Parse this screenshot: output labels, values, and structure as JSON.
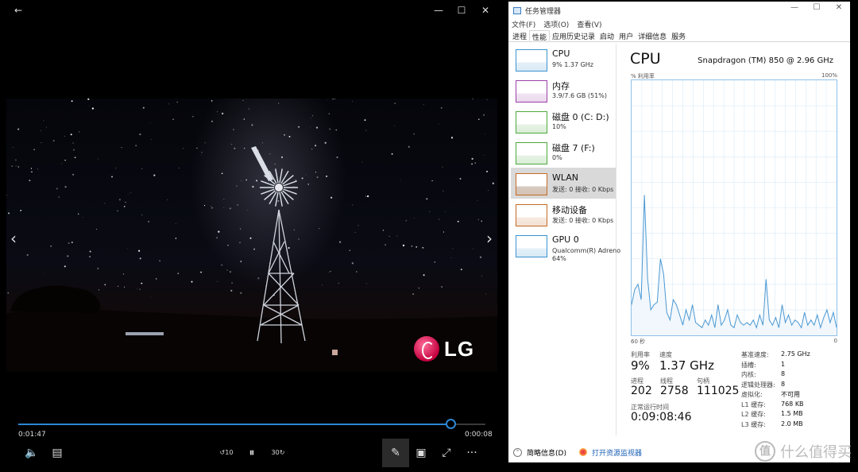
{
  "player": {
    "back_icon": "←",
    "minimize_icon": "—",
    "maximize_icon": "☐",
    "close_icon": "✕",
    "prev_icon": "‹",
    "next_icon": "›",
    "logo_text": "LG",
    "elapsed": "0:01:47",
    "remaining": "0:00:08",
    "progress": 0.925,
    "controls": {
      "volume_icon": "🔈",
      "subtitles_icon": "▤",
      "rewind_label": "10",
      "pause_icon": "⏸",
      "forward_label": "30",
      "edit_icon": "✎",
      "miniview_icon": "▣",
      "fullscreen_icon": "⤢",
      "more_icon": "···"
    }
  },
  "taskmanager": {
    "title": "任务管理器",
    "window_buttons": [
      "—",
      "☐",
      "✕"
    ],
    "menu": [
      "文件(F)",
      "选项(O)",
      "查看(V)"
    ],
    "tabs": [
      "进程",
      "性能",
      "应用历史记录",
      "启动",
      "用户",
      "详细信息",
      "服务"
    ],
    "selected_tab": 1,
    "sidebar": [
      {
        "name": "CPU",
        "sub": "9%  1.37 GHz",
        "color": "#3c92d0"
      },
      {
        "name": "内存",
        "sub": "3.9/7.6 GB (51%)",
        "color": "#9b3fa8"
      },
      {
        "name": "磁盘 0 (C: D:)",
        "sub": "10%",
        "color": "#4ca93c"
      },
      {
        "name": "磁盘 7 (F:)",
        "sub": "0%",
        "color": "#4ca93c"
      },
      {
        "name": "WLAN",
        "sub": "发送: 0  接收: 0 Kbps",
        "color": "#c46a24"
      },
      {
        "name": "移动设备",
        "sub": "发送: 0  接收: 0 Kbps",
        "color": "#c46a24"
      },
      {
        "name": "GPU 0",
        "sub": "Qualcomm(R) Adreno",
        "sub2": "64%",
        "color": "#3c92d0"
      }
    ],
    "selected_sidebar": 4,
    "main": {
      "title": "CPU",
      "model": "Snapdragon (TM) 850 @ 2.96 GHz",
      "y_label": "% 利用率",
      "y_max": "100%",
      "x_left": "60 秒",
      "x_right": "0",
      "utilization_label": "利用率",
      "utilization": "9%",
      "speed_label": "速度",
      "speed": "1.37 GHz",
      "processes_label": "进程",
      "processes": "202",
      "threads_label": "线程",
      "threads": "2758",
      "handles_label": "句柄",
      "handles": "111025",
      "uptime_label": "正常运行时间",
      "uptime": "0:09:08:46",
      "specs": [
        {
          "label": "基准速度:",
          "value": "2.75 GHz"
        },
        {
          "label": "插槽:",
          "value": "1"
        },
        {
          "label": "内核:",
          "value": "8"
        },
        {
          "label": "逻辑处理器:",
          "value": "8"
        },
        {
          "label": "虚拟化:",
          "value": "不可用"
        },
        {
          "label": "L1 缓存:",
          "value": "768 KB"
        },
        {
          "label": "L2 缓存:",
          "value": "1.5 MB"
        },
        {
          "label": "L3 缓存:",
          "value": "2.0 MB"
        }
      ],
      "cpu_history": [
        12,
        18,
        20,
        14,
        55,
        22,
        10,
        12,
        13,
        30,
        24,
        9,
        6,
        14,
        12,
        8,
        4,
        10,
        6,
        12,
        5,
        4,
        3,
        6,
        4,
        8,
        3,
        12,
        4,
        6,
        10,
        4,
        3,
        8,
        5,
        4,
        5,
        4,
        6,
        3,
        8,
        4,
        22,
        6,
        4,
        7,
        3,
        12,
        5,
        8,
        4,
        6,
        5,
        3,
        9,
        4,
        6,
        4,
        8,
        3,
        7,
        10,
        5,
        9,
        3
      ]
    },
    "footer": {
      "collapse_icon": "⌃",
      "less_details": "简略信息(D)",
      "open_monitor": "打开资源监视器"
    }
  },
  "watermark": {
    "mark": "值",
    "text": "什么值得买"
  }
}
